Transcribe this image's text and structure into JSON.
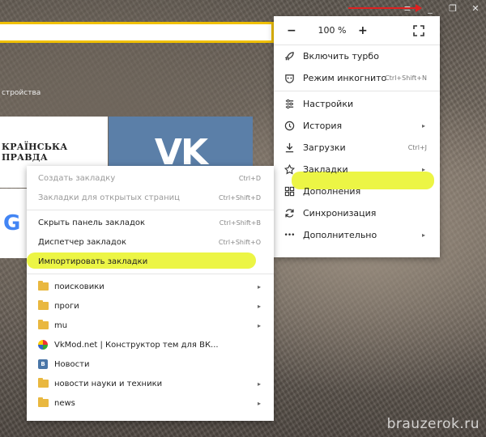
{
  "browser": {
    "devices_label": "стройства",
    "window_controls": {
      "menu_glyph": "≡",
      "minimize_glyph": "_",
      "restore_glyph": "❐",
      "close_glyph": "✕"
    }
  },
  "tiles": {
    "pravda": "КРАЇНСЬКА ПРАВДА",
    "vk_logo": "VK",
    "google_letter": "G"
  },
  "main_menu": {
    "zoom": {
      "minus": "−",
      "value": "100 %",
      "plus": "+"
    },
    "items": [
      {
        "label": "Включить турбо",
        "icon": "rocket-icon",
        "glyph": "🚀"
      },
      {
        "label": "Режим инкогнито",
        "icon": "incognito-icon",
        "glyph": "⊡",
        "shortcut": "Ctrl+Shift+N"
      },
      {
        "label": "Настройки",
        "icon": "settings-icon",
        "glyph": "☰"
      },
      {
        "label": "История",
        "icon": "history-icon",
        "glyph": "◷",
        "arrow": "▸"
      },
      {
        "label": "Загрузки",
        "icon": "download-icon",
        "glyph": "⤓",
        "shortcut": "Ctrl+J"
      },
      {
        "label": "Закладки",
        "icon": "star-icon",
        "glyph": "☆",
        "arrow": "▸"
      },
      {
        "label": "Дополнения",
        "icon": "extensions-icon",
        "glyph": "▦"
      },
      {
        "label": "Синхронизация",
        "icon": "sync-icon",
        "glyph": "⟳"
      },
      {
        "label": "Дополнительно",
        "icon": "more-icon",
        "glyph": "•••",
        "arrow": "▸"
      }
    ]
  },
  "bookmarks_menu": {
    "create": {
      "label": "Создать закладку",
      "shortcut": "Ctrl+D"
    },
    "open_pages": {
      "label": "Закладки для открытых страниц",
      "shortcut": "Ctrl+Shift+D"
    },
    "hide_bar": {
      "label": "Скрыть панель закладок",
      "shortcut": "Ctrl+Shift+B"
    },
    "manager": {
      "label": "Диспетчер закладок",
      "shortcut": "Ctrl+Shift+O"
    },
    "import": {
      "label": "Импортировать закладки"
    },
    "entries": [
      {
        "label": "поисковики",
        "type": "folder",
        "arrow": "▸"
      },
      {
        "label": "проги",
        "type": "folder",
        "arrow": "▸"
      },
      {
        "label": "mu",
        "type": "folder",
        "arrow": "▸"
      },
      {
        "label": "VkMod.net | Конструктор тем для ВК...",
        "type": "site"
      },
      {
        "label": "Новости",
        "type": "vk"
      },
      {
        "label": "новости науки и техники",
        "type": "folder",
        "arrow": "▸"
      },
      {
        "label": "news",
        "type": "folder",
        "arrow": "▸"
      }
    ]
  },
  "watermark": "brauzerok.ru",
  "colors": {
    "highlight": "#ecf545",
    "addressbar_border": "#f0c000",
    "vk_blue": "#5b7fa8",
    "arrow_red": "#e02020"
  }
}
